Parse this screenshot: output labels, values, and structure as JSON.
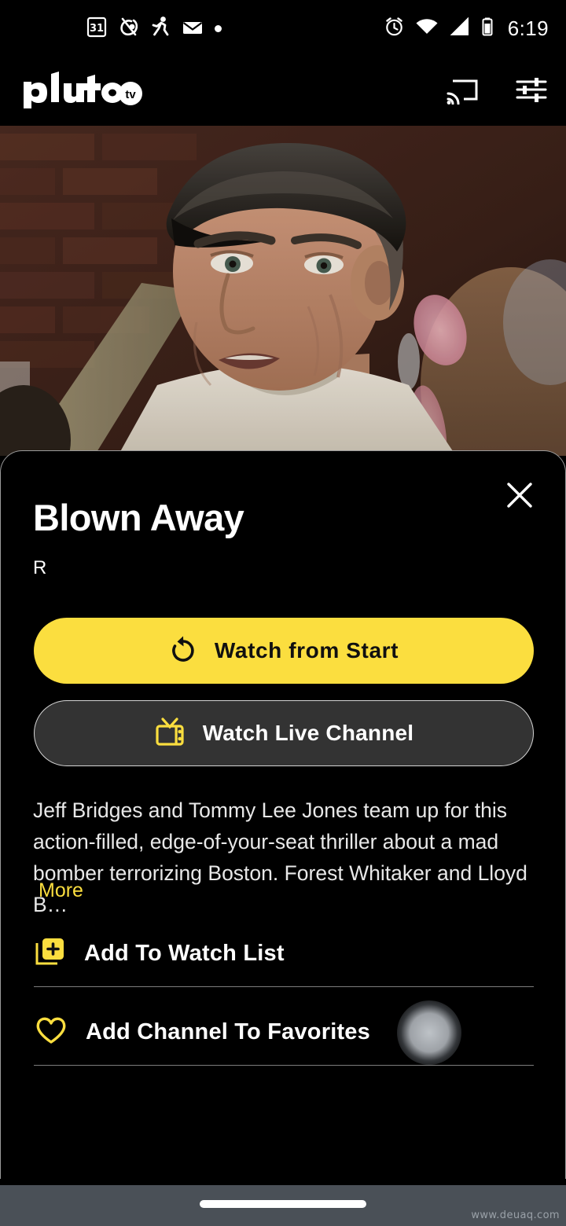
{
  "status_bar": {
    "time": "6:19",
    "left_icons": [
      {
        "name": "calendar-icon",
        "label": "31"
      },
      {
        "name": "loop-swirl-icon",
        "label": ""
      },
      {
        "name": "running-person-icon",
        "label": ""
      },
      {
        "name": "mail-envelope-icon",
        "label": ""
      },
      {
        "name": "notification-dot-icon",
        "label": ""
      }
    ],
    "right_icons": [
      {
        "name": "alarm-clock-icon",
        "label": ""
      },
      {
        "name": "wifi-icon",
        "label": ""
      },
      {
        "name": "cellular-signal-icon",
        "label": ""
      },
      {
        "name": "battery-icon",
        "label": ""
      }
    ]
  },
  "app_bar": {
    "logo_text": "pluto",
    "logo_badge": "tv",
    "cast_icon": "cast-icon",
    "filter_icon": "filter-sliders-icon"
  },
  "hero": {
    "alt": "video-still-man-in-cap"
  },
  "modal": {
    "close_icon": "close-icon",
    "title": "Blown Away",
    "rating": "R",
    "primary_button": {
      "label": "Watch from Start",
      "icon": "restart-rotate-icon"
    },
    "secondary_button": {
      "label": "Watch Live Channel",
      "icon": "retro-tv-icon"
    },
    "description": "Jeff Bridges and Tommy Lee Jones team up for this action-filled, edge-of-your-seat thriller about a mad bomber terrorizing Boston. Forest Whitaker and Lloyd B…",
    "more_label": "More",
    "rows": [
      {
        "label": "Add To Watch List",
        "icon": "add-to-watchlist-icon"
      },
      {
        "label": "Add Channel To Favorites",
        "icon": "heart-outline-icon"
      }
    ]
  },
  "nav_bar": {
    "home_indicator": "home-indicator",
    "watermark": "www.deuaq.com"
  },
  "colors": {
    "accent_yellow": "#FBDE3F",
    "background": "#000000",
    "secondary_button_bg": "#333333",
    "nav_bar": "#4A5057",
    "divider": "#7D7D7D"
  }
}
